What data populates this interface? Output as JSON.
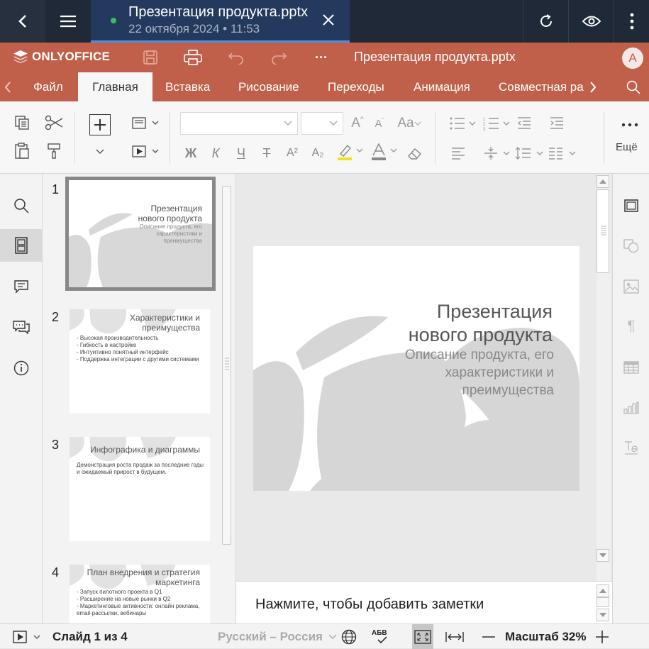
{
  "topbar": {
    "tab_title": "Презентация продукта.pptx",
    "tab_subtitle": "22 октября 2024 • 11:53"
  },
  "header": {
    "brand": "ONLYOFFICE",
    "doc_title": "Презентация продукта.pptx",
    "avatar_initial": "A",
    "more": "···"
  },
  "ribbon_tabs": [
    "Файл",
    "Главная",
    "Вставка",
    "Рисование",
    "Переходы",
    "Анимация",
    "Совместная ра"
  ],
  "toolbar": {
    "more_label": "Ещё",
    "bold": "Ж",
    "italic": "К",
    "underline": "Ч",
    "strike": "Т",
    "superscript": "A²",
    "subscript": "A₂"
  },
  "slides": [
    {
      "num": "1",
      "title": [
        "Презентация",
        "нового продукта"
      ],
      "subtitle": [
        "Описание продукта, его",
        "характеристики и",
        "преимущества"
      ]
    },
    {
      "num": "2",
      "title": [
        "Характеристики и",
        "преимущества"
      ],
      "bullets": [
        "- Высокая производительность",
        "- Гибкость в настройке",
        "- Интуитивно понятный интерфейс",
        "- Поддержка интеграции с другими системами"
      ]
    },
    {
      "num": "3",
      "title": [
        "Инфографика и диаграммы"
      ],
      "bullets": [
        "Демонстрация роста продаж за последние годы и ожидаемый прирост в будущем."
      ]
    },
    {
      "num": "4",
      "title": [
        "План внедрения и стратегия",
        "маркетинга"
      ],
      "bullets": [
        "- Запуск пилотного проекта в Q1",
        "- Расширение на новые рынки в Q2",
        "- Маркетинговые активности: онлайн реклама, email-рассылки, вебинары"
      ]
    }
  ],
  "current_slide": {
    "title_line1": "Презентация",
    "title_line2": "нового продукта",
    "sub_line1": "Описание продукта, его",
    "sub_line2": "характеристики и",
    "sub_line3": "преимущества"
  },
  "notes_placeholder": "Нажмите, чтобы добавить заметки",
  "status": {
    "slide_counter": "Слайд 1 из 4",
    "language": "Русский – Россия",
    "zoom": "Масштаб 32%",
    "spell_label": "АБВ"
  },
  "colors": {
    "topbar": "#1f2937",
    "brand": "#c0604a",
    "active_tab": "#233a5e"
  }
}
